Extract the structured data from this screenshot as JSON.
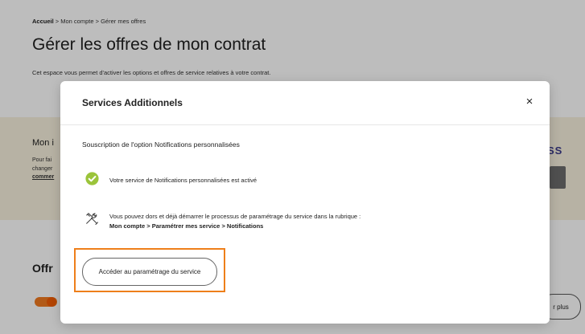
{
  "breadcrumb": {
    "home": "Accueil",
    "sep1": " > ",
    "account": "Mon compte",
    "sep2": " > ",
    "current": "Gérer mes offres"
  },
  "page": {
    "title": "Gérer les offres de mon contrat",
    "description": "Cet espace vous permet d'activer les options et offres de service relatives à votre contrat."
  },
  "background_card": {
    "title": "Mon i",
    "text_lines": [
      "Pour fai",
      "changer",
      "commer"
    ],
    "brand_text": "SS"
  },
  "offers": {
    "title": "Offr",
    "more_button": "r plus"
  },
  "modal": {
    "title": "Services Additionnels",
    "close": "×",
    "subtitle": "Souscription de l'option Notifications personnalisées",
    "active_message": "Votre service de Notifications personnalisées est activé",
    "info_line1": "Vous pouvez dors et déjà démarrer le processus de paramétrage du service dans la rubrique :",
    "info_line2": "Mon compte > Paramétrer mes service > Notifications",
    "config_button": "Accéder au paramétrage du service"
  },
  "colors": {
    "accent": "#ee7f1a",
    "check_green": "#9bc43a",
    "band": "#f7f0dd"
  },
  "icons": {
    "close": "close-icon",
    "check": "check-circle-icon",
    "tools": "tools-icon"
  }
}
